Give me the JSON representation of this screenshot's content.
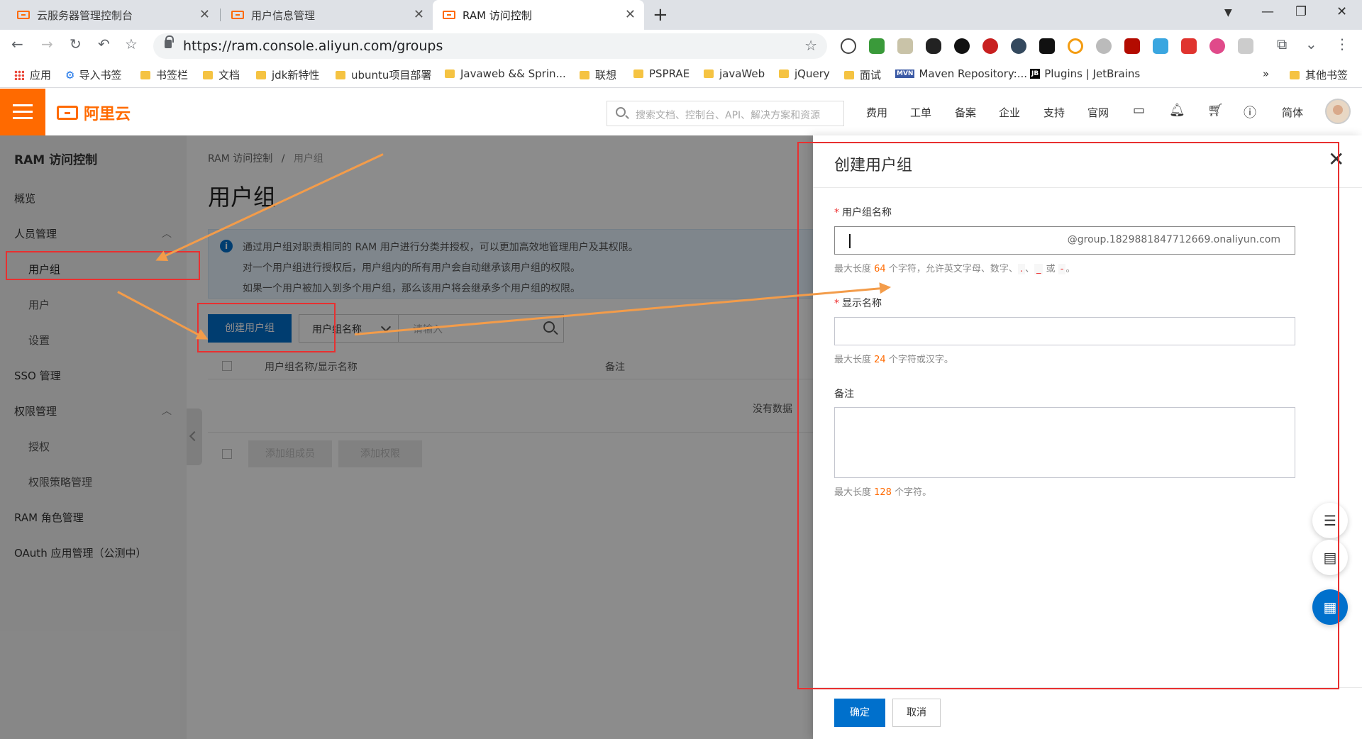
{
  "browser": {
    "tabs": [
      {
        "title": "云服务器管理控制台",
        "close": "✕"
      },
      {
        "title": "用户信息管理",
        "close": "✕"
      },
      {
        "title": "RAM 访问控制",
        "close": "✕"
      }
    ],
    "new_tab": "+",
    "url": "https://ram.console.aliyun.com/groups",
    "bookmarks": [
      {
        "label": "应用",
        "icon": "apps-grid-icon"
      },
      {
        "label": "导入书签",
        "icon": "gear-icon"
      },
      {
        "label": "书签栏",
        "icon": "folder-icon"
      },
      {
        "label": "文档",
        "icon": "folder-icon"
      },
      {
        "label": "jdk新特性",
        "icon": "folder-icon"
      },
      {
        "label": "ubuntu项目部署",
        "icon": "folder-icon"
      },
      {
        "label": "Javaweb && Sprin...",
        "icon": "folder-icon"
      },
      {
        "label": "联想",
        "icon": "folder-icon"
      },
      {
        "label": "PSPRAE",
        "icon": "folder-icon"
      },
      {
        "label": "javaWeb",
        "icon": "folder-icon"
      },
      {
        "label": "jQuery",
        "icon": "folder-icon"
      },
      {
        "label": "面试",
        "icon": "folder-icon"
      },
      {
        "label": "Maven Repository:...",
        "icon": "maven-icon"
      },
      {
        "label": "Plugins | JetBrains",
        "icon": "jetbrains-icon"
      }
    ],
    "bookmarks_more": "»",
    "other_bookmarks": "其他书签"
  },
  "header": {
    "logo": "阿里云",
    "search_placeholder": "搜索文档、控制台、API、解决方案和资源",
    "nav": [
      "费用",
      "工单",
      "备案",
      "企业",
      "支持",
      "官网"
    ],
    "lang": "简体"
  },
  "sidebar": {
    "title": "RAM 访问控制",
    "items": [
      {
        "label": "概览"
      },
      {
        "label": "人员管理"
      },
      {
        "label": "用户组"
      },
      {
        "label": "用户"
      },
      {
        "label": "设置"
      },
      {
        "label": "SSO 管理"
      },
      {
        "label": "权限管理"
      },
      {
        "label": "授权"
      },
      {
        "label": "权限策略管理"
      },
      {
        "label": "RAM 角色管理"
      },
      {
        "label": "OAuth 应用管理（公测中）"
      }
    ]
  },
  "main": {
    "breadcrumb": [
      "RAM 访问控制",
      "用户组"
    ],
    "breadcrumb_sep": "/",
    "title": "用户组",
    "info_icon": "i",
    "info_lines": [
      "通过用户组对职责相同的 RAM 用户进行分类并授权，可以更加高效地管理用户及其权限。",
      "对一个用户组进行授权后，用户组内的所有用户会自动继承该用户组的权限。",
      "如果一个用户被加入到多个用户组，那么该用户将会继承多个用户组的权限。"
    ],
    "create_button": "创建用户组",
    "filter_select": "用户组名称",
    "filter_placeholder": "请输入",
    "columns": [
      "用户组名称/显示名称",
      "备注"
    ],
    "no_data": "没有数据",
    "add_member_button": "添加组成员",
    "add_permission_button": "添加权限"
  },
  "drawer": {
    "title": "创建用户组",
    "close": "✕",
    "fields": [
      {
        "label": "用户组名称",
        "required": true,
        "suffix": "@group.1829881847712669.onaliyun.com",
        "hint_pre": "最大长度 ",
        "hint_num": "64",
        "hint_post": " 个字符，允许英文字母、数字、",
        "hint_c1": ".",
        "hint_sep": "、",
        "hint_c2": "_",
        "hint_or": " 或 ",
        "hint_c3": "-",
        "hint_end": "。"
      },
      {
        "label": "显示名称",
        "required": true,
        "hint_pre": "最大长度 ",
        "hint_num": "24",
        "hint_post": " 个字符或汉字。"
      },
      {
        "label": "备注",
        "required": false,
        "hint_pre": "最大长度 ",
        "hint_num": "128",
        "hint_post": " 个字符。"
      }
    ],
    "ok_button": "确定",
    "cancel_button": "取消"
  },
  "colors": {
    "brand": "#ff6a00",
    "primary": "#0070cc",
    "annotation_red": "#e83030",
    "annotation_arrow": "#f39c4a"
  }
}
